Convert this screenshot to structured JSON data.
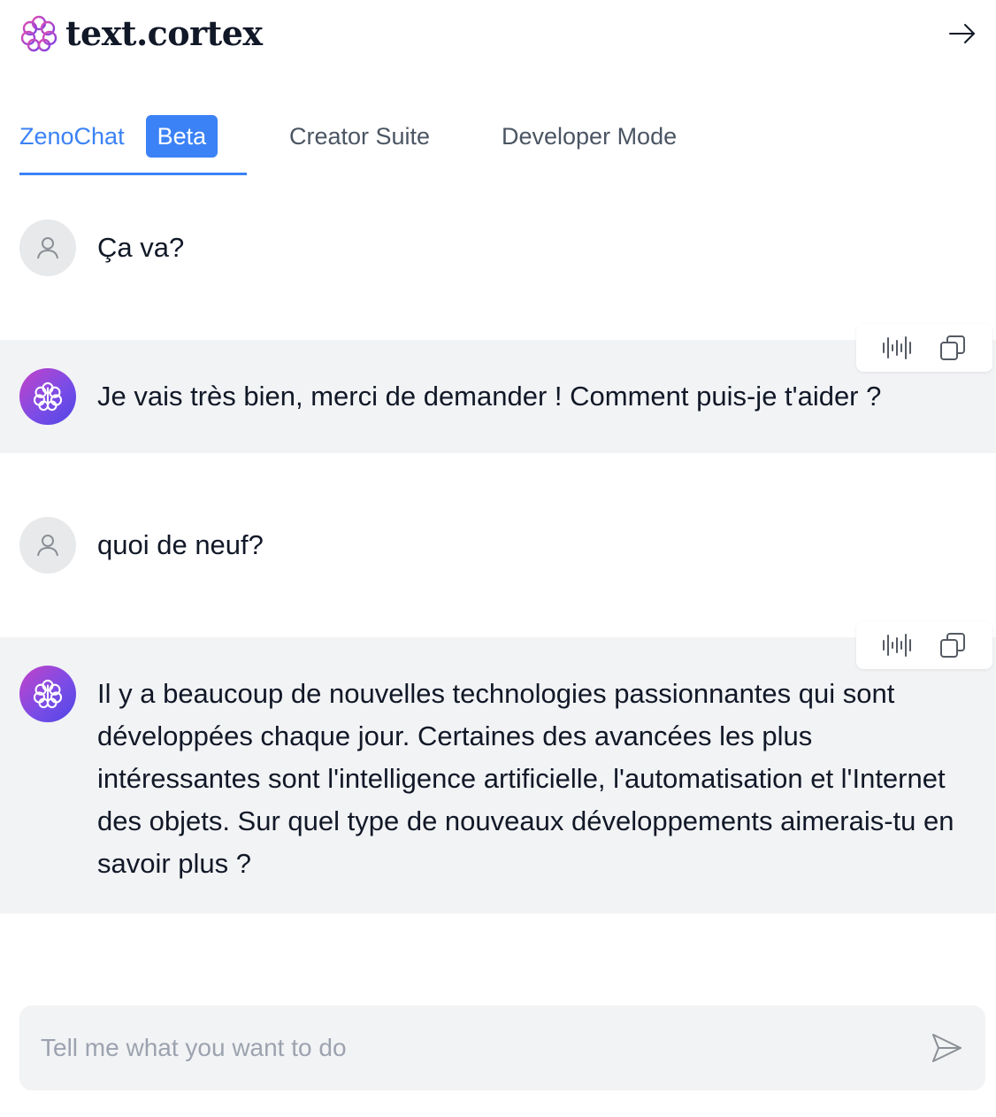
{
  "header": {
    "brand": "text.cortex",
    "logo_icon": "brain-icon",
    "collapse_icon": "arrow-right-icon"
  },
  "tabs": [
    {
      "label": "ZenoChat",
      "badge": "Beta",
      "active": true
    },
    {
      "label": "Creator Suite",
      "active": false
    },
    {
      "label": "Developer Mode",
      "active": false
    }
  ],
  "messages": [
    {
      "role": "user",
      "text": "Ça va?"
    },
    {
      "role": "assistant",
      "text": "Je vais très bien, merci de demander ! Comment puis-je t'aider ?"
    },
    {
      "role": "user",
      "text": "quoi de neuf?"
    },
    {
      "role": "assistant",
      "text": "Il y a beaucoup de nouvelles technologies passionnantes qui sont développées chaque jour. Certaines des avancées les plus intéressantes sont l'intelligence artificielle, l'automatisation et l'Internet des objets. Sur quel type de nouveaux développements aimerais-tu en savoir plus ?"
    }
  ],
  "message_actions": {
    "speak_icon": "audio-waveform-icon",
    "copy_icon": "copy-icon"
  },
  "composer": {
    "placeholder": "Tell me what you want to do",
    "value": "",
    "send_icon": "send-icon"
  },
  "colors": {
    "accent": "#3b82f6",
    "bot_row_bg": "#f2f3f5",
    "text": "#111827",
    "muted": "#4b5563"
  }
}
